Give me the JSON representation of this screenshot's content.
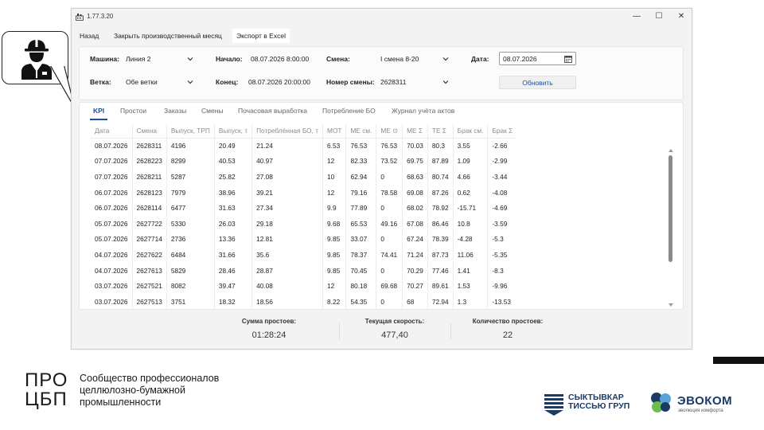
{
  "window": {
    "title": "1.77.3.20",
    "controls": {
      "minimize": "—",
      "maximize": "☐",
      "close": "✕"
    }
  },
  "menu": {
    "back": "Назад",
    "close_month": "Закрыть производственный месяц",
    "export": "Экспорт в Excel"
  },
  "filters": {
    "machine": {
      "label": "Машина:",
      "value": "Линия 2"
    },
    "start": {
      "label": "Начало:",
      "value": "08.07.2026 8:00:00"
    },
    "shift": {
      "label": "Смена:",
      "value": "I смена 8-20"
    },
    "date": {
      "label": "Дата:",
      "value": "08.07.2026"
    },
    "branch": {
      "label": "Ветка:",
      "value": "Обе ветки"
    },
    "end": {
      "label": "Конец:",
      "value": "08.07.2026 20:00:00"
    },
    "shift_number": {
      "label": "Номер смены:",
      "value": "2628311"
    },
    "refresh_label": "Обновить"
  },
  "tabs": [
    "KPI",
    "Простои",
    "Заказы",
    "Смены",
    "Почасовая выработка",
    "Потребление БО",
    "Журнал учёта актов"
  ],
  "table": {
    "headers": [
      "Дата",
      "Смена",
      "Выпуск, ТРП",
      "Выпуск, т",
      "Потреблённая БО, т",
      "МОТ",
      "МЕ см.",
      "МЕ ⊙",
      "МЕ Σ",
      "ТЕ Σ",
      "Брак см.",
      "Брак Σ"
    ],
    "rows": [
      [
        "08.07.2026",
        "2628311",
        "4196",
        "20.49",
        "21.24",
        "6.53",
        "76.53",
        "76.53",
        "70.03",
        "80.3",
        "3.55",
        "-2.66"
      ],
      [
        "07.07.2026",
        "2628223",
        "8299",
        "40.53",
        "40.97",
        "12",
        "82.33",
        "73.52",
        "69.75",
        "87.89",
        "1.09",
        "-2.99"
      ],
      [
        "07.07.2026",
        "2628211",
        "5287",
        "25.82",
        "27.08",
        "10",
        "62.94",
        "0",
        "68.63",
        "80.74",
        "4.66",
        "-3.44"
      ],
      [
        "06.07.2026",
        "2628123",
        "7979",
        "38.96",
        "39.21",
        "12",
        "79.16",
        "78.58",
        "69.08",
        "87.26",
        "0.62",
        "-4.08"
      ],
      [
        "06.07.2026",
        "2628114",
        "6477",
        "31.63",
        "27.34",
        "9.9",
        "77.89",
        "0",
        "68.02",
        "78.92",
        "-15.71",
        "-4.69"
      ],
      [
        "05.07.2026",
        "2627722",
        "5330",
        "26.03",
        "29.18",
        "9.68",
        "65.53",
        "49.16",
        "67.08",
        "86.46",
        "10.8",
        "-3.59"
      ],
      [
        "05.07.2026",
        "2627714",
        "2736",
        "13.36",
        "12.81",
        "9.85",
        "33.07",
        "0",
        "67.24",
        "78.39",
        "-4.28",
        "-5.3"
      ],
      [
        "04.07.2026",
        "2627622",
        "6484",
        "31.66",
        "35.6",
        "9.85",
        "78.37",
        "74.41",
        "71.24",
        "87.73",
        "11.06",
        "-5.35"
      ],
      [
        "04.07.2026",
        "2627613",
        "5829",
        "28.46",
        "28.87",
        "9.85",
        "70.45",
        "0",
        "70.29",
        "77.46",
        "1.41",
        "-8.3"
      ],
      [
        "03.07.2026",
        "2627521",
        "8082",
        "39.47",
        "40.08",
        "12",
        "80.18",
        "69.68",
        "70.27",
        "89.61",
        "1.53",
        "-9.96"
      ],
      [
        "03.07.2026",
        "2627513",
        "3751",
        "18.32",
        "18.56",
        "8.22",
        "54.35",
        "0",
        "68",
        "72.94",
        "1.3",
        "-13.53"
      ]
    ]
  },
  "footer": {
    "downtime_sum": {
      "label": "Сумма простоев:",
      "value": "01:28:24"
    },
    "current_speed": {
      "label": "Текущая скорость:",
      "value": "477,40"
    },
    "downtime_count": {
      "label": "Количество простоев:",
      "value": "22"
    }
  },
  "branding": {
    "pro_line1": "ПРО",
    "pro_line2": "ЦБП",
    "community_line1": "Сообщество профессионалов",
    "community_line2": "целлюлозно-бумажной",
    "community_line3": "промышленности",
    "syktyvkar_line1": "СЫКТЫВКАР",
    "syktyvkar_line2": "ТИССЬЮ ГРУП",
    "evokom_name": "ЭВОКОМ",
    "evokom_tagline": "эволюция комфорта"
  },
  "icons": {
    "presenter": "worker-helmet-icon",
    "calendar": "calendar-icon",
    "dropdown": "chevron-down-icon"
  },
  "colors": {
    "accent": "#1d4fa0",
    "brand_dark": "#1c3a66"
  }
}
